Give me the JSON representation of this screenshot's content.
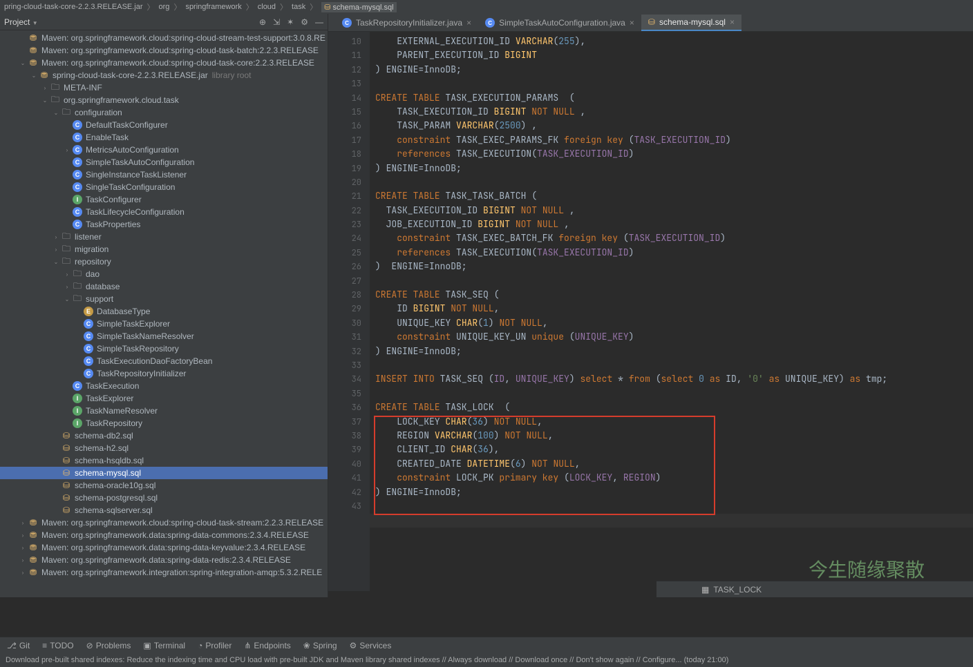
{
  "crumb": {
    "jar": "pring-cloud-task-core-2.2.3.RELEASE.jar",
    "p1": "org",
    "p2": "springframework",
    "p3": "cloud",
    "p4": "task",
    "file": "schema-mysql.sql"
  },
  "sidebar": {
    "title": "Project"
  },
  "tree": [
    {
      "d": 1,
      "t": "lib",
      "c": "",
      "l": "Maven: org.springframework.cloud:spring-cloud-stream-test-support:3.0.8.RE"
    },
    {
      "d": 1,
      "t": "lib",
      "c": "",
      "l": "Maven: org.springframework.cloud:spring-cloud-task-batch:2.2.3.RELEASE"
    },
    {
      "d": 1,
      "t": "lib",
      "c": "v",
      "l": "Maven: org.springframework.cloud:spring-cloud-task-core:2.2.3.RELEASE"
    },
    {
      "d": 2,
      "t": "jar",
      "c": "v",
      "l": "spring-cloud-task-core-2.2.3.RELEASE.jar",
      "sub": "library root"
    },
    {
      "d": 3,
      "t": "fold",
      "c": ">",
      "l": "META-INF"
    },
    {
      "d": 3,
      "t": "pkg",
      "c": "v",
      "l": "org.springframework.cloud.task"
    },
    {
      "d": 4,
      "t": "pkg",
      "c": "v",
      "l": "configuration"
    },
    {
      "d": 5,
      "t": "C",
      "c": "",
      "l": "DefaultTaskConfigurer"
    },
    {
      "d": 5,
      "t": "C",
      "c": "",
      "l": "EnableTask"
    },
    {
      "d": 5,
      "t": "C",
      "c": ">",
      "l": "MetricsAutoConfiguration"
    },
    {
      "d": 5,
      "t": "C",
      "c": "",
      "l": "SimpleTaskAutoConfiguration"
    },
    {
      "d": 5,
      "t": "C",
      "c": "",
      "l": "SingleInstanceTaskListener"
    },
    {
      "d": 5,
      "t": "C",
      "c": "",
      "l": "SingleTaskConfiguration"
    },
    {
      "d": 5,
      "t": "I",
      "c": "",
      "l": "TaskConfigurer"
    },
    {
      "d": 5,
      "t": "C",
      "c": "",
      "l": "TaskLifecycleConfiguration"
    },
    {
      "d": 5,
      "t": "C",
      "c": "",
      "l": "TaskProperties"
    },
    {
      "d": 4,
      "t": "pkg",
      "c": ">",
      "l": "listener"
    },
    {
      "d": 4,
      "t": "pkg",
      "c": ">",
      "l": "migration"
    },
    {
      "d": 4,
      "t": "pkg",
      "c": "v",
      "l": "repository"
    },
    {
      "d": 5,
      "t": "pkg",
      "c": ">",
      "l": "dao"
    },
    {
      "d": 5,
      "t": "pkg",
      "c": ">",
      "l": "database"
    },
    {
      "d": 5,
      "t": "pkg",
      "c": "v",
      "l": "support"
    },
    {
      "d": 6,
      "t": "E",
      "c": "",
      "l": "DatabaseType"
    },
    {
      "d": 6,
      "t": "C",
      "c": "",
      "l": "SimpleTaskExplorer"
    },
    {
      "d": 6,
      "t": "C",
      "c": "",
      "l": "SimpleTaskNameResolver"
    },
    {
      "d": 6,
      "t": "C",
      "c": "",
      "l": "SimpleTaskRepository"
    },
    {
      "d": 6,
      "t": "C",
      "c": "",
      "l": "TaskExecutionDaoFactoryBean"
    },
    {
      "d": 6,
      "t": "C",
      "c": "",
      "l": "TaskRepositoryInitializer"
    },
    {
      "d": 5,
      "t": "C",
      "c": "",
      "l": "TaskExecution"
    },
    {
      "d": 5,
      "t": "I",
      "c": "",
      "l": "TaskExplorer"
    },
    {
      "d": 5,
      "t": "I",
      "c": "",
      "l": "TaskNameResolver"
    },
    {
      "d": 5,
      "t": "I",
      "c": "",
      "l": "TaskRepository"
    },
    {
      "d": 4,
      "t": "sql",
      "c": "",
      "l": "schema-db2.sql"
    },
    {
      "d": 4,
      "t": "sql",
      "c": "",
      "l": "schema-h2.sql"
    },
    {
      "d": 4,
      "t": "sql",
      "c": "",
      "l": "schema-hsqldb.sql"
    },
    {
      "d": 4,
      "t": "sql",
      "c": "",
      "l": "schema-mysql.sql",
      "sel": true
    },
    {
      "d": 4,
      "t": "sql",
      "c": "",
      "l": "schema-oracle10g.sql"
    },
    {
      "d": 4,
      "t": "sql",
      "c": "",
      "l": "schema-postgresql.sql"
    },
    {
      "d": 4,
      "t": "sql",
      "c": "",
      "l": "schema-sqlserver.sql"
    },
    {
      "d": 1,
      "t": "lib",
      "c": ">",
      "l": "Maven: org.springframework.cloud:spring-cloud-task-stream:2.2.3.RELEASE"
    },
    {
      "d": 1,
      "t": "lib",
      "c": ">",
      "l": "Maven: org.springframework.data:spring-data-commons:2.3.4.RELEASE"
    },
    {
      "d": 1,
      "t": "lib",
      "c": ">",
      "l": "Maven: org.springframework.data:spring-data-keyvalue:2.3.4.RELEASE"
    },
    {
      "d": 1,
      "t": "lib",
      "c": ">",
      "l": "Maven: org.springframework.data:spring-data-redis:2.3.4.RELEASE"
    },
    {
      "d": 1,
      "t": "lib",
      "c": ">",
      "l": "Maven: org.springframework.integration:spring-integration-amqp:5.3.2.RELE"
    }
  ],
  "tabs": [
    {
      "icon": "j",
      "label": "TaskRepositoryInitializer.java",
      "act": false
    },
    {
      "icon": "j",
      "label": "SimpleTaskAutoConfiguration.java",
      "act": false
    },
    {
      "icon": "s",
      "label": "schema-mysql.sql",
      "act": true
    }
  ],
  "editor": {
    "startLine": 10,
    "lines": [
      {
        "seg": [
          {
            "c": "p",
            "t": "    EXTERNAL_EXECUTION_ID "
          },
          {
            "c": "fn",
            "t": "VARCHAR"
          },
          {
            "c": "p",
            "t": "("
          },
          {
            "c": "num",
            "t": "255"
          },
          {
            "c": "p",
            "t": "),"
          }
        ]
      },
      {
        "seg": [
          {
            "c": "p",
            "t": "    PARENT_EXECUTION_ID "
          },
          {
            "c": "fn",
            "t": "BIGINT"
          }
        ]
      },
      {
        "seg": [
          {
            "c": "p",
            "t": ") ENGINE=InnoDB;"
          }
        ]
      },
      {
        "seg": []
      },
      {
        "seg": [
          {
            "c": "kw",
            "t": "CREATE TABLE"
          },
          {
            "c": "p",
            "t": " TASK_EXECUTION_PARAMS  ("
          }
        ]
      },
      {
        "seg": [
          {
            "c": "p",
            "t": "    TASK_EXECUTION_ID "
          },
          {
            "c": "fn",
            "t": "BIGINT"
          },
          {
            "c": "kw",
            "t": " NOT NULL "
          },
          {
            "c": "p",
            "t": ","
          }
        ]
      },
      {
        "seg": [
          {
            "c": "p",
            "t": "    TASK_PARAM "
          },
          {
            "c": "fn",
            "t": "VARCHAR"
          },
          {
            "c": "p",
            "t": "("
          },
          {
            "c": "num",
            "t": "2500"
          },
          {
            "c": "p",
            "t": ") ,"
          }
        ]
      },
      {
        "seg": [
          {
            "c": "kw",
            "t": "    constraint"
          },
          {
            "c": "p",
            "t": " TASK_EXEC_PARAMS_FK "
          },
          {
            "c": "kw",
            "t": "foreign key"
          },
          {
            "c": "p",
            "t": " ("
          },
          {
            "c": "col",
            "t": "TASK_EXECUTION_ID"
          },
          {
            "c": "p",
            "t": ")"
          }
        ]
      },
      {
        "seg": [
          {
            "c": "kw",
            "t": "    references"
          },
          {
            "c": "p",
            "t": " TASK_EXECUTION("
          },
          {
            "c": "col",
            "t": "TASK_EXECUTION_ID"
          },
          {
            "c": "p",
            "t": ")"
          }
        ]
      },
      {
        "seg": [
          {
            "c": "p",
            "t": ") ENGINE=InnoDB;"
          }
        ]
      },
      {
        "seg": []
      },
      {
        "seg": [
          {
            "c": "kw",
            "t": "CREATE TABLE"
          },
          {
            "c": "p",
            "t": " TASK_TASK_BATCH ("
          }
        ]
      },
      {
        "seg": [
          {
            "c": "p",
            "t": "  TASK_EXECUTION_ID "
          },
          {
            "c": "fn",
            "t": "BIGINT"
          },
          {
            "c": "kw",
            "t": " NOT NULL "
          },
          {
            "c": "p",
            "t": ","
          }
        ]
      },
      {
        "seg": [
          {
            "c": "p",
            "t": "  JOB_EXECUTION_ID "
          },
          {
            "c": "fn",
            "t": "BIGINT"
          },
          {
            "c": "kw",
            "t": " NOT NULL "
          },
          {
            "c": "p",
            "t": ","
          }
        ]
      },
      {
        "seg": [
          {
            "c": "kw",
            "t": "    constraint"
          },
          {
            "c": "p",
            "t": " TASK_EXEC_BATCH_FK "
          },
          {
            "c": "kw",
            "t": "foreign key"
          },
          {
            "c": "p",
            "t": " ("
          },
          {
            "c": "col",
            "t": "TASK_EXECUTION_ID"
          },
          {
            "c": "p",
            "t": ")"
          }
        ]
      },
      {
        "seg": [
          {
            "c": "kw",
            "t": "    references"
          },
          {
            "c": "p",
            "t": " TASK_EXECUTION("
          },
          {
            "c": "col",
            "t": "TASK_EXECUTION_ID"
          },
          {
            "c": "p",
            "t": ")"
          }
        ]
      },
      {
        "seg": [
          {
            "c": "p",
            "t": ")  ENGINE=InnoDB;"
          }
        ]
      },
      {
        "seg": []
      },
      {
        "seg": [
          {
            "c": "kw",
            "t": "CREATE TABLE"
          },
          {
            "c": "p",
            "t": " TASK_SEQ ("
          }
        ]
      },
      {
        "seg": [
          {
            "c": "p",
            "t": "    ID "
          },
          {
            "c": "fn",
            "t": "BIGINT"
          },
          {
            "c": "kw",
            "t": " NOT NULL"
          },
          {
            "c": "p",
            "t": ","
          }
        ]
      },
      {
        "seg": [
          {
            "c": "p",
            "t": "    UNIQUE_KEY "
          },
          {
            "c": "fn",
            "t": "CHAR"
          },
          {
            "c": "p",
            "t": "("
          },
          {
            "c": "num",
            "t": "1"
          },
          {
            "c": "p",
            "t": ") "
          },
          {
            "c": "kw",
            "t": "NOT NULL"
          },
          {
            "c": "p",
            "t": ","
          }
        ]
      },
      {
        "seg": [
          {
            "c": "kw",
            "t": "    constraint"
          },
          {
            "c": "p",
            "t": " UNIQUE_KEY_UN "
          },
          {
            "c": "kw",
            "t": "unique"
          },
          {
            "c": "p",
            "t": " ("
          },
          {
            "c": "col",
            "t": "UNIQUE_KEY"
          },
          {
            "c": "p",
            "t": ")"
          }
        ]
      },
      {
        "seg": [
          {
            "c": "p",
            "t": ") ENGINE=InnoDB;"
          }
        ]
      },
      {
        "seg": []
      },
      {
        "seg": [
          {
            "c": "kw",
            "t": "INSERT INTO"
          },
          {
            "c": "p",
            "t": " TASK_SEQ ("
          },
          {
            "c": "col",
            "t": "ID"
          },
          {
            "c": "p",
            "t": ", "
          },
          {
            "c": "col",
            "t": "UNIQUE_KEY"
          },
          {
            "c": "p",
            "t": ") "
          },
          {
            "c": "kw",
            "t": "select"
          },
          {
            "c": "p",
            "t": " * "
          },
          {
            "c": "kw",
            "t": "from"
          },
          {
            "c": "p",
            "t": " ("
          },
          {
            "c": "kw",
            "t": "select"
          },
          {
            "c": "p",
            "t": " "
          },
          {
            "c": "num",
            "t": "0"
          },
          {
            "c": "p",
            "t": " "
          },
          {
            "c": "kw",
            "t": "as"
          },
          {
            "c": "p",
            "t": " ID, "
          },
          {
            "c": "str",
            "t": "'0'"
          },
          {
            "c": "p",
            "t": " "
          },
          {
            "c": "kw",
            "t": "as"
          },
          {
            "c": "p",
            "t": " UNIQUE_KEY) "
          },
          {
            "c": "kw",
            "t": "as"
          },
          {
            "c": "p",
            "t": " tmp;"
          }
        ]
      },
      {
        "seg": []
      },
      {
        "seg": [
          {
            "c": "kw",
            "t": "CREATE TABLE"
          },
          {
            "c": "p",
            "t": " TASK_LOCK  ("
          }
        ]
      },
      {
        "seg": [
          {
            "c": "p",
            "t": "    LOCK_KEY "
          },
          {
            "c": "fn",
            "t": "CHAR"
          },
          {
            "c": "p",
            "t": "("
          },
          {
            "c": "num",
            "t": "36"
          },
          {
            "c": "p",
            "t": ") "
          },
          {
            "c": "kw",
            "t": "NOT NULL"
          },
          {
            "c": "p",
            "t": ","
          }
        ]
      },
      {
        "seg": [
          {
            "c": "p",
            "t": "    REGION "
          },
          {
            "c": "fn",
            "t": "VARCHAR"
          },
          {
            "c": "p",
            "t": "("
          },
          {
            "c": "num",
            "t": "100"
          },
          {
            "c": "p",
            "t": ") "
          },
          {
            "c": "kw",
            "t": "NOT NULL"
          },
          {
            "c": "p",
            "t": ","
          }
        ]
      },
      {
        "seg": [
          {
            "c": "p",
            "t": "    CLIENT_ID "
          },
          {
            "c": "fn",
            "t": "CHAR"
          },
          {
            "c": "p",
            "t": "("
          },
          {
            "c": "num",
            "t": "36"
          },
          {
            "c": "p",
            "t": "),"
          }
        ]
      },
      {
        "seg": [
          {
            "c": "p",
            "t": "    CREATED_DATE "
          },
          {
            "c": "fn",
            "t": "DATETIME"
          },
          {
            "c": "p",
            "t": "("
          },
          {
            "c": "num",
            "t": "6"
          },
          {
            "c": "p",
            "t": ") "
          },
          {
            "c": "kw",
            "t": "NOT NULL"
          },
          {
            "c": "p",
            "t": ","
          }
        ]
      },
      {
        "seg": [
          {
            "c": "kw",
            "t": "    constraint"
          },
          {
            "c": "p",
            "t": " LOCK_PK "
          },
          {
            "c": "kw",
            "t": "primary key"
          },
          {
            "c": "p",
            "t": " ("
          },
          {
            "c": "col",
            "t": "LOCK_KEY"
          },
          {
            "c": "p",
            "t": ", "
          },
          {
            "c": "col",
            "t": "REGION"
          },
          {
            "c": "p",
            "t": ")"
          }
        ]
      },
      {
        "seg": [
          {
            "c": "p",
            "t": ") ENGINE=InnoDB;"
          }
        ]
      },
      {
        "seg": []
      }
    ]
  },
  "statusPath": "TASK_LOCK",
  "bottomBar": [
    "Git",
    "TODO",
    "Problems",
    "Terminal",
    "Profiler",
    "Endpoints",
    "Spring",
    "Services"
  ],
  "notif": {
    "left": "Download pre-built shared indexes: Reduce the indexing time and CPU load with pre-built JDK and Maven library shared indexes // Always download // Download once // Don't show again // Configure... (today 21:00)"
  },
  "watermark": "今生随缘聚散"
}
